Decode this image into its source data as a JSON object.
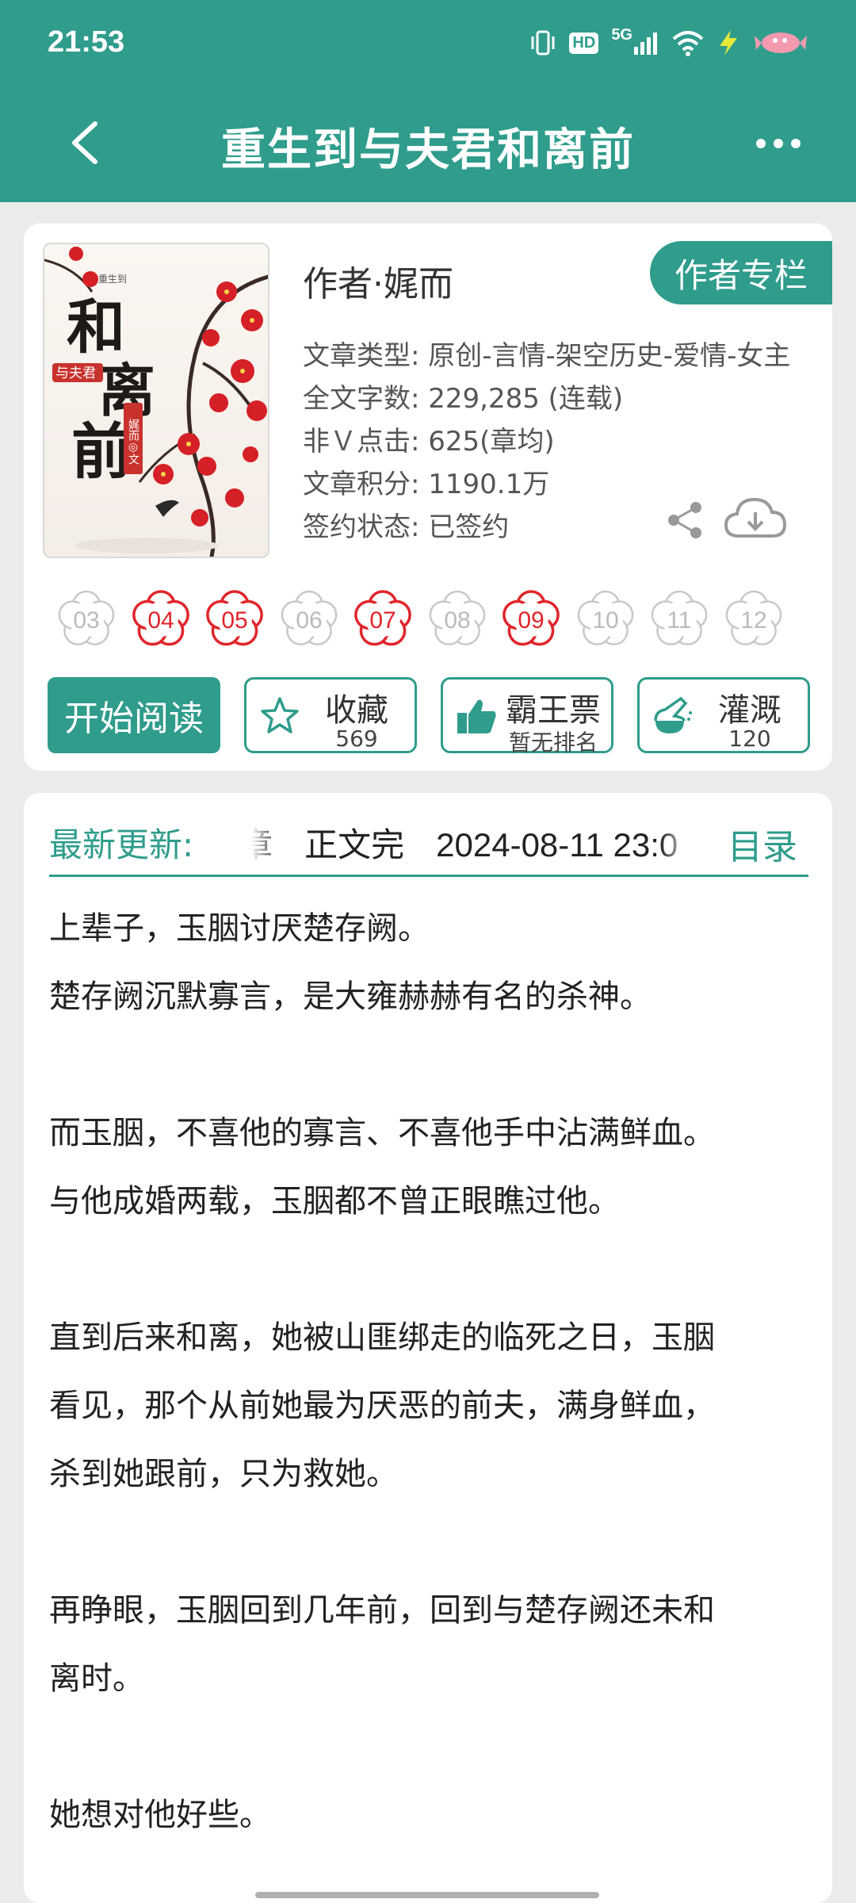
{
  "status_bar": {
    "time": "21:53",
    "hd": "HD",
    "network": "5G",
    "icons": [
      "vibrate-icon",
      "hd-icon",
      "signal-icon",
      "wifi-icon",
      "charging-icon",
      "battery-icon"
    ]
  },
  "header": {
    "title": "重生到与夫君和离前",
    "back_icon": "chevron-left-icon",
    "more_icon": "more-dots-icon"
  },
  "book": {
    "cover_title": "和离前",
    "cover_subtitle": "与夫君",
    "cover_series": "重生到",
    "cover_author_stamp": "娓而◎文",
    "author_line": "作者·娓而",
    "author_column_button": "作者专栏",
    "meta": [
      "文章类型: 原创-言情-架空历史-爱情-女主",
      "全文字数: 229,285 (连载)",
      "非Ｖ点击: 625(章均)",
      "文章积分: 1190.1万",
      "签约状态: 已签约"
    ],
    "share_icon": "share-icon",
    "download_icon": "cloud-download-icon"
  },
  "episodes": [
    {
      "label": "03",
      "active": false
    },
    {
      "label": "04",
      "active": true
    },
    {
      "label": "05",
      "active": true
    },
    {
      "label": "06",
      "active": false
    },
    {
      "label": "07",
      "active": true
    },
    {
      "label": "08",
      "active": false
    },
    {
      "label": "09",
      "active": true
    },
    {
      "label": "10",
      "active": false
    },
    {
      "label": "11",
      "active": false
    },
    {
      "label": "12",
      "active": false
    }
  ],
  "colors": {
    "accent": "#2f9c8c",
    "active_flower": "#e0252b",
    "inactive_flower": "#c8c8c8"
  },
  "actions": {
    "start_reading": "开始阅读",
    "favorite": {
      "label": "收藏",
      "count": "569",
      "icon": "star-icon"
    },
    "overlord_ticket": {
      "label": "霸王票",
      "sub": "暂无排名",
      "icon": "thumbs-up-icon"
    },
    "irrigate": {
      "label": "灌溉",
      "count": "120",
      "icon": "nutrient-bottle-icon"
    }
  },
  "update": {
    "label": "最新更新:",
    "partial": "章",
    "status": "正文完",
    "timestamp": "2024-08-11 23:0",
    "toc": "目录"
  },
  "summary_lines": [
    "上辈子，玉胭讨厌楚存阙。",
    "楚存阙沉默寡言，是大雍赫赫有名的杀神。",
    "",
    "而玉胭，不喜他的寡言、不喜他手中沾满鲜血。",
    "与他成婚两载，玉胭都不曾正眼瞧过他。",
    "",
    "直到后来和离，她被山匪绑走的临死之日，玉胭",
    "看见，那个从前她最为厌恶的前夫，满身鲜血，",
    "杀到她跟前，只为救她。",
    "",
    "再睁眼，玉胭回到几年前，回到与楚存阙还未和",
    "离时。",
    "",
    "她想对他好些。"
  ]
}
